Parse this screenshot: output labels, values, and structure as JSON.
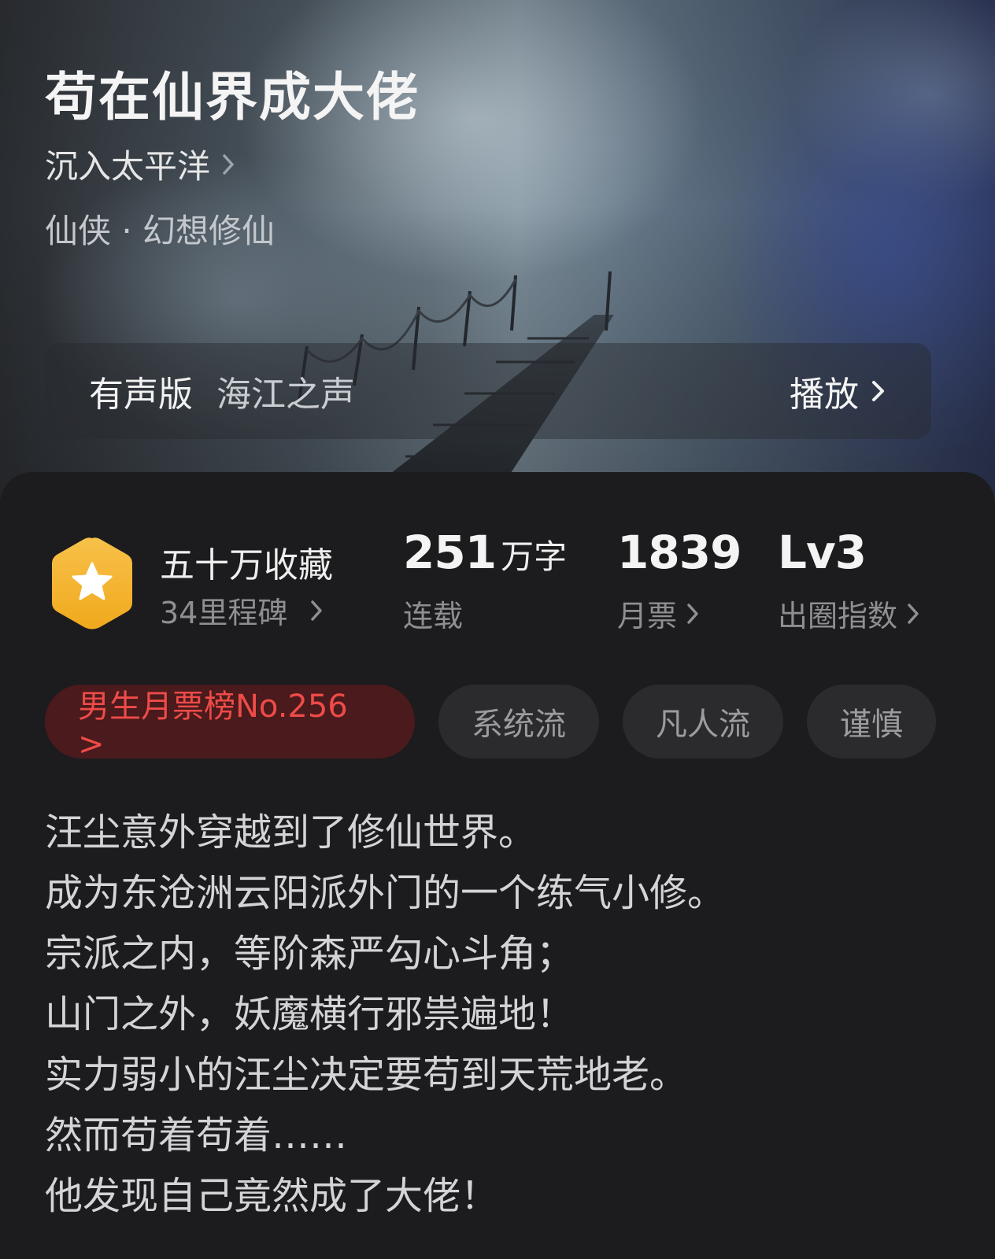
{
  "header": {
    "title": "苟在仙界成大佬",
    "author": "沉入太平洋",
    "genre": "仙侠 · 幻想修仙"
  },
  "audio": {
    "label": "有声版",
    "narrator": "海江之声",
    "play_label": "播放"
  },
  "stats": {
    "collection": {
      "title": "五十万收藏",
      "sub": "34里程碑"
    },
    "words": {
      "number": "251",
      "unit": "万字",
      "sub": "连载"
    },
    "monthly_votes": {
      "number": "1839",
      "sub": "月票"
    },
    "breakout": {
      "number": "Lv3",
      "sub": "出圈指数"
    }
  },
  "tags": [
    {
      "label": "男生月票榜No.256 >"
    },
    {
      "label": "系统流"
    },
    {
      "label": "凡人流"
    },
    {
      "label": "谨慎"
    }
  ],
  "synopsis": [
    "汪尘意外穿越到了修仙世界。",
    "成为东沧洲云阳派外门的一个练气小修。",
    "宗派之内，等阶森严勾心斗角；",
    "山门之外，妖魔横行邪祟遍地！",
    "实力弱小的汪尘决定要苟到天荒地老。",
    "然而苟着苟着……",
    "他发现自己竟然成了大佬！"
  ],
  "colors": {
    "badge": "#f5b833",
    "rank_text": "#ee4b48",
    "rank_bg": "#4a1a1c",
    "tag_bg": "#2b2b2e",
    "card_bg": "#1c1c1e"
  }
}
